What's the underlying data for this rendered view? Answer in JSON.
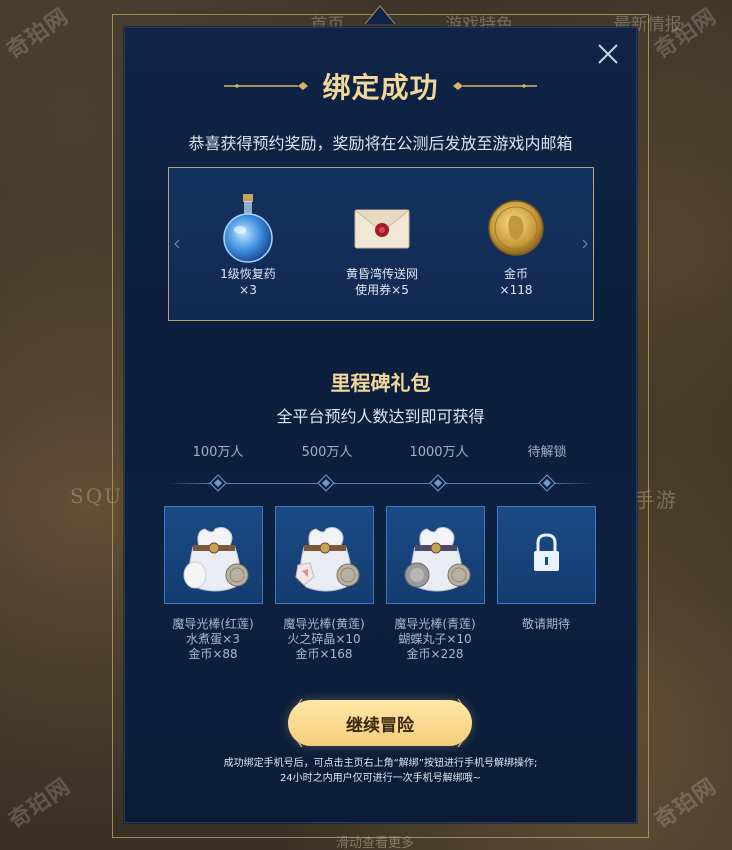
{
  "background": {
    "nav": [
      "首页",
      "游戏特色",
      "最新情报"
    ],
    "side_left": "SQU",
    "side_right": "手游",
    "footer": "滑动查看更多",
    "watermark": "奇珀网"
  },
  "modal": {
    "title": "绑定成功",
    "subtitle": "恭喜获得预约奖励，奖励将在公测后发放至游戏内邮箱",
    "close_icon": "close-icon",
    "rewards": [
      {
        "name": "1级恢复药",
        "qty": "×3",
        "icon": "potion-icon"
      },
      {
        "name": "黄昏湾传送网",
        "qty": "使用券×5",
        "icon": "envelope-icon"
      },
      {
        "name": "金币",
        "qty": "×118",
        "icon": "gold-coin-icon"
      }
    ],
    "milestone": {
      "title": "里程碑礼包",
      "subtitle": "全平台预约人数达到即可获得",
      "tiers": [
        {
          "label": "100万人",
          "lines": [
            "魔导光棒(红莲)",
            "水煮蛋×3",
            "金币×88"
          ],
          "icon": "gift-bag-icon"
        },
        {
          "label": "500万人",
          "lines": [
            "魔导光棒(黄莲)",
            "火之碎晶×10",
            "金币×168"
          ],
          "icon": "gift-bag-icon"
        },
        {
          "label": "1000万人",
          "lines": [
            "魔导光棒(青莲)",
            "蝴蝶丸子×10",
            "金币×228"
          ],
          "icon": "gift-bag-icon"
        },
        {
          "label": "待解锁",
          "lines": [
            "敬请期待"
          ],
          "icon": "lock-icon"
        }
      ]
    },
    "continue_label": "继续冒险",
    "note_lines": [
      "成功绑定手机号后，可点击主页右上角“解绑”按钮进行手机号解绑操作;",
      "24小时之内用户仅可进行一次手机号解绑哦~"
    ]
  },
  "colors": {
    "gold_text": "#f1d79a",
    "modal_bg": "#0f2446",
    "button": "#f4cd7c"
  }
}
